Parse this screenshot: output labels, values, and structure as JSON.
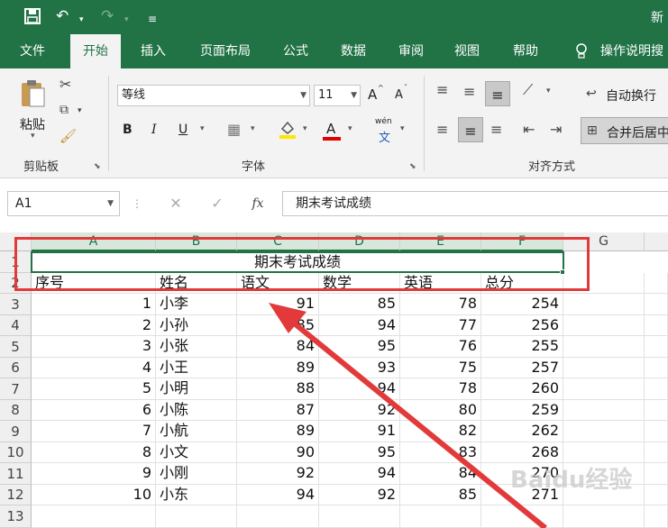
{
  "app": {
    "title_fragment": "新"
  },
  "tabs": [
    {
      "label": "文件"
    },
    {
      "label": "开始"
    },
    {
      "label": "插入"
    },
    {
      "label": "页面布局"
    },
    {
      "label": "公式"
    },
    {
      "label": "数据"
    },
    {
      "label": "审阅"
    },
    {
      "label": "视图"
    },
    {
      "label": "帮助"
    },
    {
      "label": "操作说明搜"
    }
  ],
  "active_tab": "开始",
  "ribbon": {
    "clipboard": {
      "paste_label": "粘贴",
      "group_label": "剪贴板"
    },
    "font": {
      "font_name": "等线",
      "font_size": "11",
      "bold": "B",
      "italic": "I",
      "underline": "U",
      "grow": "A",
      "shrink": "A",
      "font_color": "A",
      "wen": "wén",
      "wen_char": "文",
      "group_label": "字体"
    },
    "alignment": {
      "wrap_text": "自动换行",
      "merge_center": "合并后居中",
      "group_label": "对齐方式"
    }
  },
  "formula_bar": {
    "name_box": "A1",
    "fx": "fx",
    "cancel": "✕",
    "enter": "✓",
    "content": "期末考试成绩"
  },
  "columns": [
    "A",
    "B",
    "C",
    "D",
    "E",
    "F",
    "G"
  ],
  "rows": [
    "1",
    "2",
    "3",
    "4",
    "5",
    "6",
    "7",
    "8",
    "9",
    "10",
    "11",
    "12",
    "13"
  ],
  "sheet": {
    "merged_title": "期末考试成绩",
    "headers": [
      "序号",
      "姓名",
      "语文",
      "数学",
      "英语",
      "总分"
    ],
    "data": [
      [
        "1",
        "小李",
        "91",
        "85",
        "78",
        "254"
      ],
      [
        "2",
        "小孙",
        "85",
        "94",
        "77",
        "256"
      ],
      [
        "3",
        "小张",
        "84",
        "95",
        "76",
        "255"
      ],
      [
        "4",
        "小王",
        "89",
        "93",
        "75",
        "257"
      ],
      [
        "5",
        "小明",
        "88",
        "94",
        "78",
        "260"
      ],
      [
        "6",
        "小陈",
        "87",
        "92",
        "80",
        "259"
      ],
      [
        "7",
        "小航",
        "89",
        "91",
        "82",
        "262"
      ],
      [
        "8",
        "小文",
        "90",
        "95",
        "83",
        "268"
      ],
      [
        "9",
        "小刚",
        "92",
        "94",
        "84",
        "270"
      ],
      [
        "10",
        "小东",
        "94",
        "92",
        "85",
        "271"
      ]
    ]
  },
  "watermark": "Baidu经验",
  "colors": {
    "excel_green": "#217346",
    "annotation_red": "#e23a3a"
  }
}
